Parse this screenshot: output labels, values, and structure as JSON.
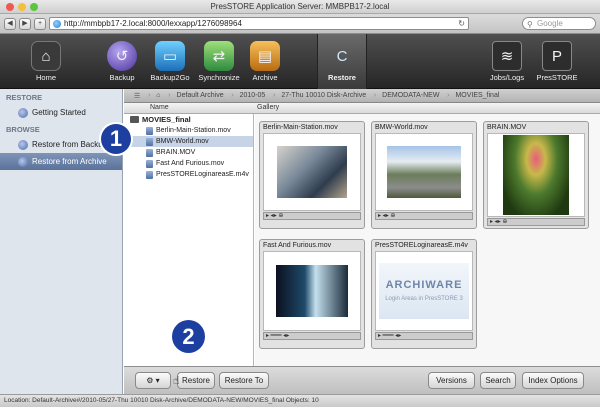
{
  "window": {
    "title": "PresSTORE Application Server: MMBPB17-2.local"
  },
  "browser": {
    "url": "http://mmbpb17-2.local:8000/lexxapp/1276098964",
    "search_placeholder": "Google",
    "back_icon": "back-arrow-icon",
    "forward_icon": "forward-arrow-icon"
  },
  "toolbar": {
    "items": [
      {
        "label": "Home",
        "icon": "house-icon"
      },
      {
        "label": "Backup",
        "icon": "backup-icon"
      },
      {
        "label": "Backup2Go",
        "icon": "backup2go-icon"
      },
      {
        "label": "Synchronize",
        "icon": "sync-icon"
      },
      {
        "label": "Archive",
        "icon": "archive-icon"
      },
      {
        "label": "Restore",
        "icon": "restore-icon",
        "active": true
      },
      {
        "label": "Jobs/Logs",
        "icon": "jobs-icon"
      },
      {
        "label": "PresSTORE",
        "icon": "presstore-icon"
      }
    ]
  },
  "sidebar": {
    "restore_header": "RESTORE",
    "browse_header": "BROWSE",
    "items": [
      {
        "label": "Getting Started"
      },
      {
        "label": "Restore from Backup"
      },
      {
        "label": "Restore from Archive",
        "selected": true
      }
    ]
  },
  "breadcrumb": [
    "Default Archive",
    "2010-05",
    "27-Thu 10010 Disk-Archive",
    "DEMODATA-NEW",
    "MOVIES_final"
  ],
  "columns": {
    "name": "Name",
    "gallery": "Gallery"
  },
  "tree": {
    "folder": "MOVIES_final",
    "files": [
      "Berlin-Main-Station.mov",
      "BMW-World.mov",
      "BRAIN.MOV",
      "Fast And Furious.mov",
      "PresSTORELoginareasE.m4v"
    ],
    "selected_index": 1
  },
  "gallery": {
    "cards": [
      {
        "title": "Berlin-Main-Station.mov"
      },
      {
        "title": "BMW-World.mov"
      },
      {
        "title": "BRAIN.MOV"
      },
      {
        "title": "Fast And Furious.mov"
      },
      {
        "title": "PresSTORELoginareasE.m4v",
        "logo": "ARCHIWARE",
        "caption": "Login Areas in PresSTORE 3"
      }
    ]
  },
  "buttons": {
    "gear": "⚙ ▾",
    "restore": "Restore",
    "restore_to": "Restore To",
    "versions": "Versions",
    "search": "Search",
    "index_options": "Index Options"
  },
  "status": {
    "text": "Location: Default-Archive#/2010-05/27-Thu 10010 Disk-Archive/DEMODATA-NEW/MOVIES_final  Objects: 10"
  },
  "callouts": {
    "first": "1",
    "second": "2"
  },
  "colors": {
    "toolbar": "#262626",
    "sidebar": "#dfe5ec",
    "selection": "#5b7299",
    "callout": "#1d3f9f"
  }
}
